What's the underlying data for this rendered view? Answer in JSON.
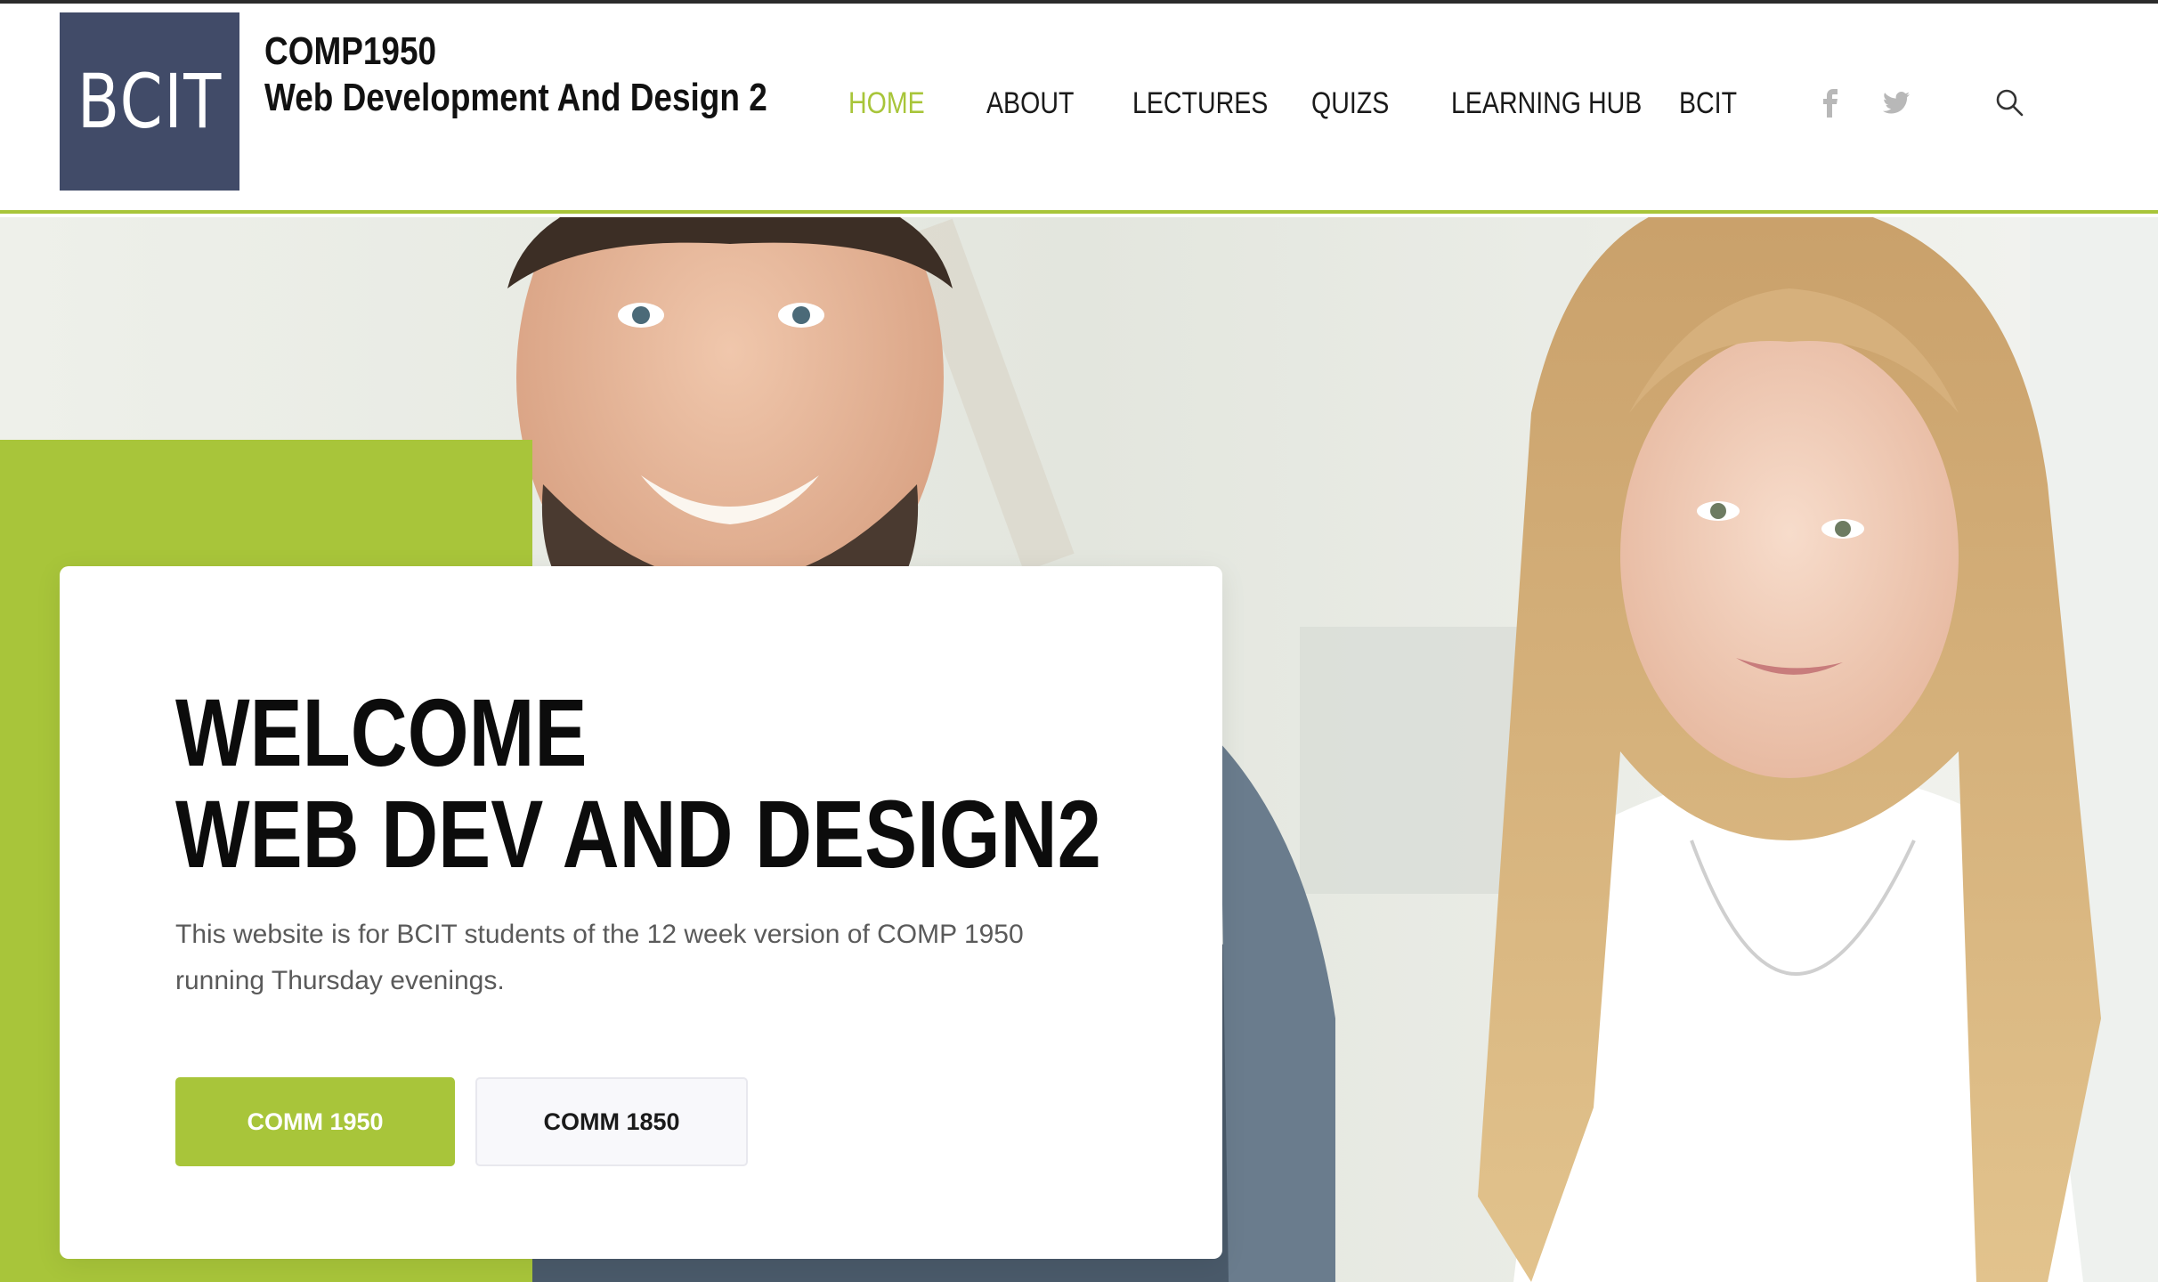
{
  "logo": {
    "text": "BCIT"
  },
  "site_title": {
    "code": "COMP1950",
    "name": "Web Development And Design 2"
  },
  "nav": {
    "items": [
      {
        "label": "HOME",
        "active": true
      },
      {
        "label": "ABOUT",
        "active": false
      },
      {
        "label": "LECTURES",
        "active": false
      },
      {
        "label": "QUIZS",
        "active": false
      },
      {
        "label": "LEARNING HUB",
        "active": false
      },
      {
        "label": "BCIT",
        "active": false
      }
    ],
    "social_icons": [
      "facebook-icon",
      "twitter-icon"
    ],
    "search_icon": "search-icon"
  },
  "hero": {
    "headline_line1": "WELCOME",
    "headline_line2": "WEB DEV AND DESIGN2",
    "description": "This website is for BCIT students of the 12 week version of COMP 1950 running Thursday evenings.",
    "primary_button": "COMM 1950",
    "secondary_button": "COMM 1850"
  },
  "colors": {
    "accent": "#a8c53a",
    "logo_bg": "#414b68",
    "text_dark": "#111111",
    "text_muted": "#5a5a5a"
  }
}
